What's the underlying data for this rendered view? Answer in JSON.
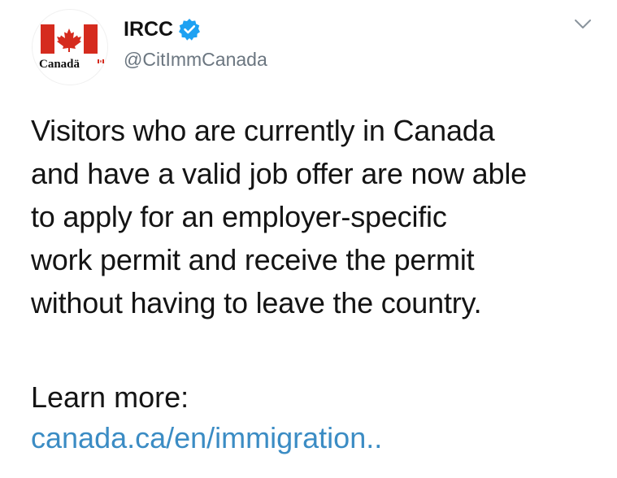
{
  "author": {
    "logo_wordmark": "Canadä",
    "display_name": "IRCC",
    "handle": "@CitImmCanada",
    "verified": true
  },
  "tweet": {
    "lines": [
      "Visitors who are currently in Canada",
      "and have a valid job offer are now able",
      "to apply for an employer-specific",
      "work permit and receive the permit",
      "without having to leave the country."
    ],
    "learn_more": "Learn more:",
    "link_text": "canada.ca/en/immigration.."
  },
  "icons": {
    "menu": "chevron-down-icon",
    "verified": "verified-badge-icon",
    "logo": "canada-flag-icon"
  },
  "colors": {
    "link": "#3b8cc4",
    "verified_badge": "#1da1f2",
    "flag_red": "#d52b1e",
    "handle_gray": "#6b7680"
  }
}
